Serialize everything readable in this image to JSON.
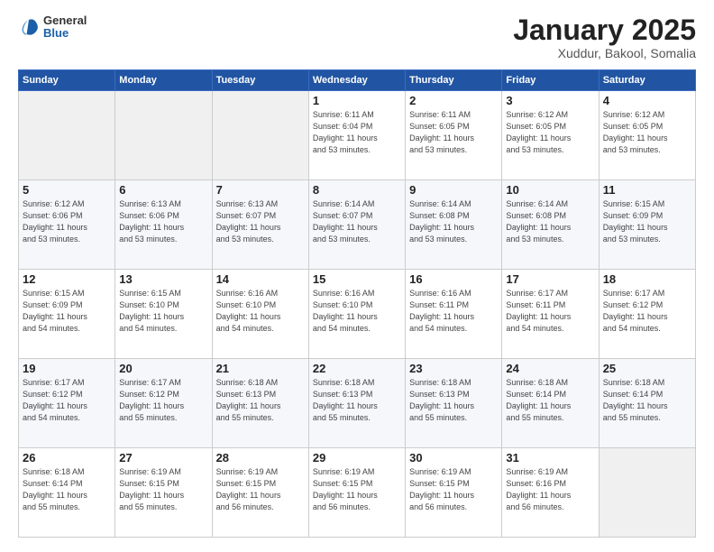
{
  "header": {
    "logo": {
      "general": "General",
      "blue": "Blue"
    },
    "title": "January 2025",
    "subtitle": "Xuddur, Bakool, Somalia"
  },
  "days_of_week": [
    "Sunday",
    "Monday",
    "Tuesday",
    "Wednesday",
    "Thursday",
    "Friday",
    "Saturday"
  ],
  "weeks": [
    [
      {
        "day": "",
        "info": ""
      },
      {
        "day": "",
        "info": ""
      },
      {
        "day": "",
        "info": ""
      },
      {
        "day": "1",
        "info": "Sunrise: 6:11 AM\nSunset: 6:04 PM\nDaylight: 11 hours\nand 53 minutes."
      },
      {
        "day": "2",
        "info": "Sunrise: 6:11 AM\nSunset: 6:05 PM\nDaylight: 11 hours\nand 53 minutes."
      },
      {
        "day": "3",
        "info": "Sunrise: 6:12 AM\nSunset: 6:05 PM\nDaylight: 11 hours\nand 53 minutes."
      },
      {
        "day": "4",
        "info": "Sunrise: 6:12 AM\nSunset: 6:05 PM\nDaylight: 11 hours\nand 53 minutes."
      }
    ],
    [
      {
        "day": "5",
        "info": "Sunrise: 6:12 AM\nSunset: 6:06 PM\nDaylight: 11 hours\nand 53 minutes."
      },
      {
        "day": "6",
        "info": "Sunrise: 6:13 AM\nSunset: 6:06 PM\nDaylight: 11 hours\nand 53 minutes."
      },
      {
        "day": "7",
        "info": "Sunrise: 6:13 AM\nSunset: 6:07 PM\nDaylight: 11 hours\nand 53 minutes."
      },
      {
        "day": "8",
        "info": "Sunrise: 6:14 AM\nSunset: 6:07 PM\nDaylight: 11 hours\nand 53 minutes."
      },
      {
        "day": "9",
        "info": "Sunrise: 6:14 AM\nSunset: 6:08 PM\nDaylight: 11 hours\nand 53 minutes."
      },
      {
        "day": "10",
        "info": "Sunrise: 6:14 AM\nSunset: 6:08 PM\nDaylight: 11 hours\nand 53 minutes."
      },
      {
        "day": "11",
        "info": "Sunrise: 6:15 AM\nSunset: 6:09 PM\nDaylight: 11 hours\nand 53 minutes."
      }
    ],
    [
      {
        "day": "12",
        "info": "Sunrise: 6:15 AM\nSunset: 6:09 PM\nDaylight: 11 hours\nand 54 minutes."
      },
      {
        "day": "13",
        "info": "Sunrise: 6:15 AM\nSunset: 6:10 PM\nDaylight: 11 hours\nand 54 minutes."
      },
      {
        "day": "14",
        "info": "Sunrise: 6:16 AM\nSunset: 6:10 PM\nDaylight: 11 hours\nand 54 minutes."
      },
      {
        "day": "15",
        "info": "Sunrise: 6:16 AM\nSunset: 6:10 PM\nDaylight: 11 hours\nand 54 minutes."
      },
      {
        "day": "16",
        "info": "Sunrise: 6:16 AM\nSunset: 6:11 PM\nDaylight: 11 hours\nand 54 minutes."
      },
      {
        "day": "17",
        "info": "Sunrise: 6:17 AM\nSunset: 6:11 PM\nDaylight: 11 hours\nand 54 minutes."
      },
      {
        "day": "18",
        "info": "Sunrise: 6:17 AM\nSunset: 6:12 PM\nDaylight: 11 hours\nand 54 minutes."
      }
    ],
    [
      {
        "day": "19",
        "info": "Sunrise: 6:17 AM\nSunset: 6:12 PM\nDaylight: 11 hours\nand 54 minutes."
      },
      {
        "day": "20",
        "info": "Sunrise: 6:17 AM\nSunset: 6:12 PM\nDaylight: 11 hours\nand 55 minutes."
      },
      {
        "day": "21",
        "info": "Sunrise: 6:18 AM\nSunset: 6:13 PM\nDaylight: 11 hours\nand 55 minutes."
      },
      {
        "day": "22",
        "info": "Sunrise: 6:18 AM\nSunset: 6:13 PM\nDaylight: 11 hours\nand 55 minutes."
      },
      {
        "day": "23",
        "info": "Sunrise: 6:18 AM\nSunset: 6:13 PM\nDaylight: 11 hours\nand 55 minutes."
      },
      {
        "day": "24",
        "info": "Sunrise: 6:18 AM\nSunset: 6:14 PM\nDaylight: 11 hours\nand 55 minutes."
      },
      {
        "day": "25",
        "info": "Sunrise: 6:18 AM\nSunset: 6:14 PM\nDaylight: 11 hours\nand 55 minutes."
      }
    ],
    [
      {
        "day": "26",
        "info": "Sunrise: 6:18 AM\nSunset: 6:14 PM\nDaylight: 11 hours\nand 55 minutes."
      },
      {
        "day": "27",
        "info": "Sunrise: 6:19 AM\nSunset: 6:15 PM\nDaylight: 11 hours\nand 55 minutes."
      },
      {
        "day": "28",
        "info": "Sunrise: 6:19 AM\nSunset: 6:15 PM\nDaylight: 11 hours\nand 56 minutes."
      },
      {
        "day": "29",
        "info": "Sunrise: 6:19 AM\nSunset: 6:15 PM\nDaylight: 11 hours\nand 56 minutes."
      },
      {
        "day": "30",
        "info": "Sunrise: 6:19 AM\nSunset: 6:15 PM\nDaylight: 11 hours\nand 56 minutes."
      },
      {
        "day": "31",
        "info": "Sunrise: 6:19 AM\nSunset: 6:16 PM\nDaylight: 11 hours\nand 56 minutes."
      },
      {
        "day": "",
        "info": ""
      }
    ]
  ]
}
